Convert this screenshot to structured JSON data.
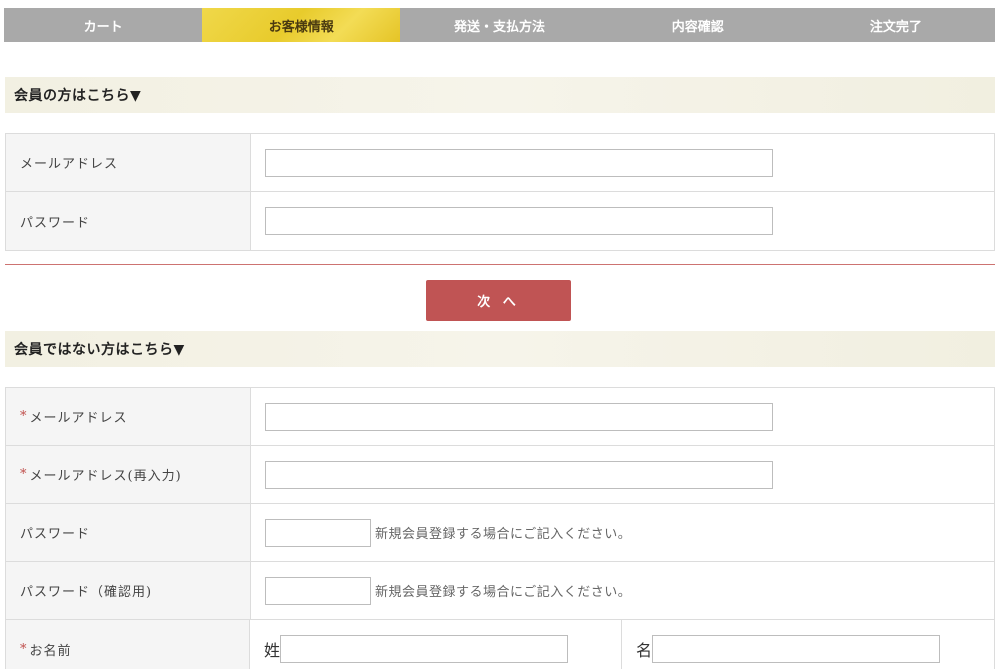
{
  "steps": [
    "カート",
    "お客様情報",
    "発送・支払方法",
    "内容確認",
    "注文完了"
  ],
  "member_section": {
    "title": "会員の方はこちら▼",
    "email_label": "メールアドレス",
    "password_label": "パスワード",
    "email_value": "",
    "password_value": ""
  },
  "next_button": "次 へ",
  "guest_section": {
    "title": "会員ではない方はこちら▼",
    "required_mark": "*",
    "email_label": "メールアドレス",
    "email_confirm_label": "メールアドレス(再入力)",
    "password_label": "パスワード",
    "password_confirm_label": "パスワード（確認用)",
    "password_hint": "新規会員登録する場合にご記入ください。",
    "name_label": "お名前",
    "last_name_label": "姓",
    "first_name_label": "名"
  },
  "colors": {
    "step_inactive": "#a9a9a9",
    "step_active": "#e8cb2c",
    "button": "#c05454",
    "required": "#c0504d"
  }
}
